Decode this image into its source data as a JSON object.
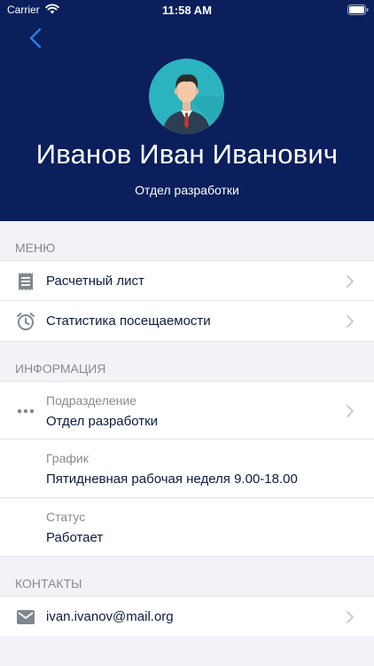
{
  "status_bar": {
    "carrier": "Carrier",
    "time": "11:58 AM"
  },
  "colors": {
    "header_bg": "#0a1f5c",
    "accent": "#2b7de0",
    "avatar_bg": "#2bb3c0"
  },
  "profile": {
    "name": "Иванов Иван Иванович",
    "department": "Отдел разработки"
  },
  "menu": {
    "title": "МЕНЮ",
    "items": [
      {
        "label": "Расчетный лист",
        "icon": "payslip-icon"
      },
      {
        "label": "Статистика посещаемости",
        "icon": "alarm-clock-icon"
      }
    ]
  },
  "info": {
    "title": "ИНФОРМАЦИЯ",
    "items": [
      {
        "caption": "Подразделение",
        "value": "Отдел разработки",
        "icon": "more-dots-icon"
      },
      {
        "caption": "График",
        "value": "Пятидневная рабочая неделя 9.00-18.00"
      },
      {
        "caption": "Статус",
        "value": "Работает"
      }
    ]
  },
  "contacts": {
    "title": "КОНТАКТЫ",
    "items": [
      {
        "label": "ivan.ivanov@mail.org",
        "icon": "mail-icon"
      }
    ]
  }
}
